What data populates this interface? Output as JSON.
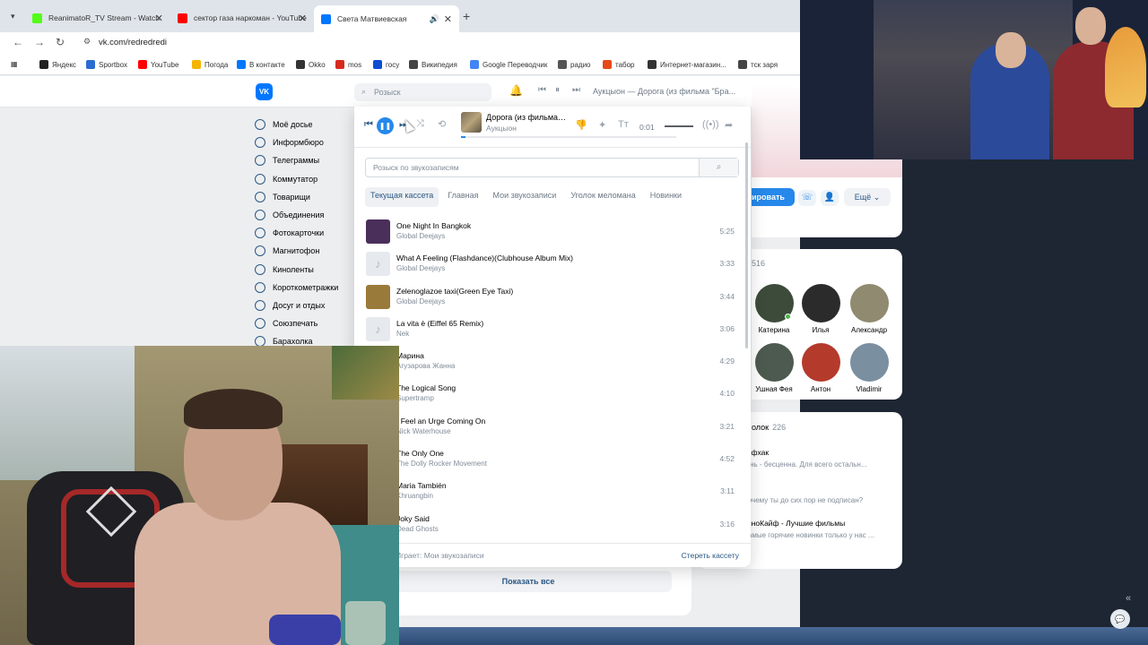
{
  "browser": {
    "tabs": [
      {
        "title": "ReanimatoR_TV Stream - Watch",
        "color": "#53fc18",
        "active": false
      },
      {
        "title": "сектор газа наркоман - YouTube",
        "color": "#ff0000",
        "active": false
      },
      {
        "title": "Света Матвиевская",
        "color": "#0077ff",
        "active": true
      }
    ],
    "url": "vk.com/redredredi",
    "bookmarks": [
      {
        "label": "Яндекс",
        "color": "#222"
      },
      {
        "label": "Sportbox",
        "color": "#2a6bd1"
      },
      {
        "label": "YouTube",
        "color": "#ff0000"
      },
      {
        "label": "Погода",
        "color": "#f4b400"
      },
      {
        "label": "В контакте",
        "color": "#0077ff"
      },
      {
        "label": "Okko",
        "color": "#333"
      },
      {
        "label": "mos",
        "color": "#d52b1e"
      },
      {
        "label": "госу",
        "color": "#0d4cd3"
      },
      {
        "label": "Википедия",
        "color": "#444"
      },
      {
        "label": "Google Переводчик",
        "color": "#4285f4"
      },
      {
        "label": "радио",
        "color": "#555"
      },
      {
        "label": "табор",
        "color": "#e64a19"
      },
      {
        "label": "Интернет-магазин...",
        "color": "#333"
      },
      {
        "label": "тск заря",
        "color": "#444"
      }
    ]
  },
  "vk": {
    "logo": "VK",
    "search_placeholder": "Розыск",
    "now_playing": "Аукцыон — Дорога (из фильма \"Бра...",
    "menu": [
      "Моё досье",
      "Информбюро",
      "Телеграммы",
      "Коммутатор",
      "Товарищи",
      "Объединения",
      "Фотокарточки",
      "Магнитофон",
      "Киноленты",
      "Короткометражки",
      "Досуг и отдых",
      "Союзпечать",
      "Барахолка"
    ],
    "profile": {
      "write_button": "ировать",
      "more_button": "Ещё"
    },
    "friends": {
      "count": "516",
      "people": [
        {
          "name": "Катерина",
          "color": "#3c4b3a",
          "online": true
        },
        {
          "name": "Илья",
          "color": "#2b2b2b",
          "online": false
        },
        {
          "name": "Александр",
          "color": "#8f8a70",
          "online": false
        },
        {
          "name": "Ушная Фея",
          "color": "#4d5a4f",
          "online": false
        },
        {
          "name": "Антон",
          "color": "#b43a2c",
          "online": false
        },
        {
          "name": "Vladimir",
          "color": "#7a8fa0",
          "online": false
        }
      ]
    },
    "groups": {
      "title": "олок",
      "count": "226",
      "items": [
        {
          "name": "айфхак",
          "sub": "изнь - бесценна. Для всего остальн...",
          "color": "#e8ebee"
        },
        {
          "name": "ed",
          "sub": "Почему ты до сих пор не подписан?",
          "color": "#8a2f2a"
        },
        {
          "name": "КиноКайф - Лучшие фильмы",
          "sub": "Самые горячие новинки только у нас ...",
          "color": "#f5a300"
        }
      ]
    },
    "show_all": "Показать все"
  },
  "audio": {
    "current": {
      "title": "Дорога (из фильма \"Брат\")",
      "artist": "Аукцыон",
      "time": "0:01",
      "progress": 0.02
    },
    "search_placeholder": "Розыск по звукозаписям",
    "tabs": [
      "Текущая кассета",
      "Главная",
      "Мои звукозаписи",
      "Уголок меломана",
      "Новинки"
    ],
    "tracks": [
      {
        "title": "One Night In Bangkok",
        "artist": "Global Deejays",
        "duration": "5:25",
        "cover": "#4a2f5a"
      },
      {
        "title": "What A Feeling (Flashdance)(Clubhouse Album Mix)",
        "artist": "Global Deejays",
        "duration": "3:33",
        "cover": ""
      },
      {
        "title": "Zelenoglazoe taxi(Green Eye Taxi)",
        "artist": "Global Deejays",
        "duration": "3:44",
        "cover": "#9a7a3a"
      },
      {
        "title": "La vita è (Eiffel 65 Remix)",
        "artist": "Nek",
        "duration": "3:06",
        "cover": ""
      },
      {
        "title": "Марина",
        "artist": "Агузарова Жанна",
        "duration": "4:29",
        "cover": ""
      },
      {
        "title": "The Logical Song",
        "artist": "Supertramp",
        "duration": "4:10",
        "cover": ""
      },
      {
        "title": "I Feel an Urge Coming On",
        "artist": "Nick Waterhouse",
        "duration": "3:21",
        "cover": ""
      },
      {
        "title": "The Only One",
        "artist": "The Dolly Rocker Movement",
        "duration": "4:52",
        "cover": ""
      },
      {
        "title": "Maria También",
        "artist": "Khruangbin",
        "duration": "3:11",
        "cover": ""
      },
      {
        "title": "Joky Said",
        "artist": "Dead Ghosts",
        "duration": "3:16",
        "cover": ""
      }
    ],
    "footer_source": "Играет: Мои звукозаписи",
    "footer_clear": "Стереть кассету"
  }
}
